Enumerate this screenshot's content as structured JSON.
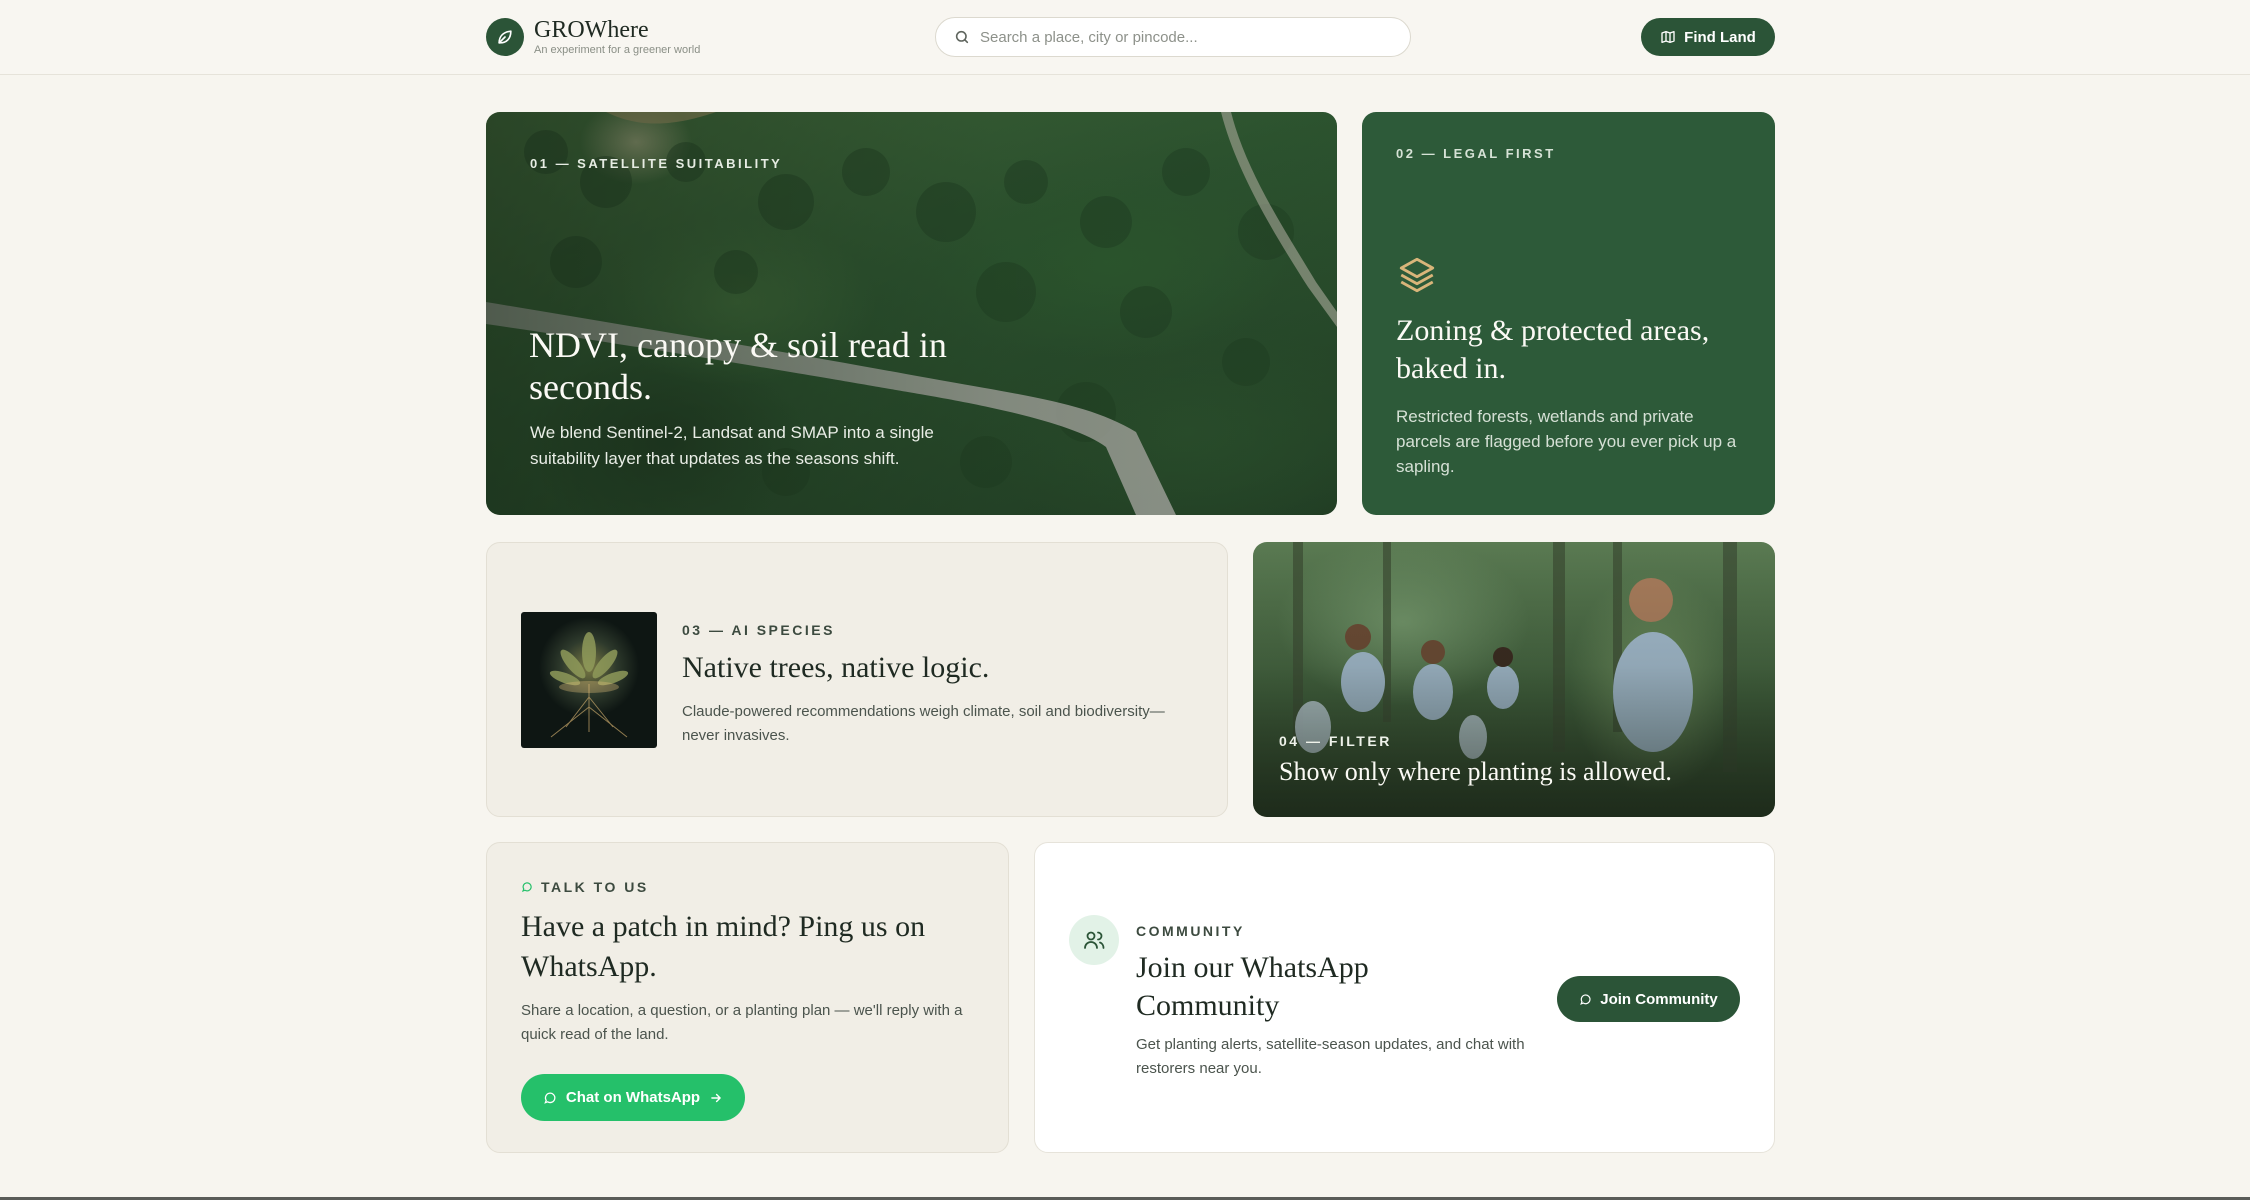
{
  "header": {
    "brand": "GROWhere",
    "tagline": "An experiment for a greener world",
    "search_placeholder": "Search a place, city or pincode...",
    "find_land_label": "Find Land"
  },
  "cards": {
    "satellite": {
      "eyebrow": "01 — SATELLITE SUITABILITY",
      "title": "NDVI, canopy & soil read in seconds.",
      "body": "We blend Sentinel-2, Landsat and SMAP into a single suitability layer that updates as the seasons shift."
    },
    "legal": {
      "eyebrow": "02 — LEGAL FIRST",
      "title": "Zoning & protected areas, baked in.",
      "body": "Restricted forests, wetlands and private parcels are flagged before you ever pick up a sapling."
    },
    "species": {
      "eyebrow": "03 — AI SPECIES",
      "title": "Native trees, native logic.",
      "body": "Claude-powered recommendations weigh climate, soil and biodiversity—never invasives."
    },
    "filter": {
      "eyebrow": "04 — FILTER",
      "title": "Show only where planting is allowed."
    },
    "talk": {
      "eyebrow": "TALK TO US",
      "title": "Have a patch in mind? Ping us on WhatsApp.",
      "body": "Share a location, a question, or a planting plan — we'll reply with a quick read of the land.",
      "button_label": "Chat on WhatsApp"
    },
    "community": {
      "eyebrow": "COMMUNITY",
      "title": "Join our WhatsApp Community",
      "body": "Get planting alerts, satellite-season updates, and chat with restorers near you.",
      "button_label": "Join Community"
    }
  },
  "colors": {
    "brand_green": "#2b5437",
    "whatsapp_green": "#25c06a",
    "background": "#f7f5ef"
  }
}
